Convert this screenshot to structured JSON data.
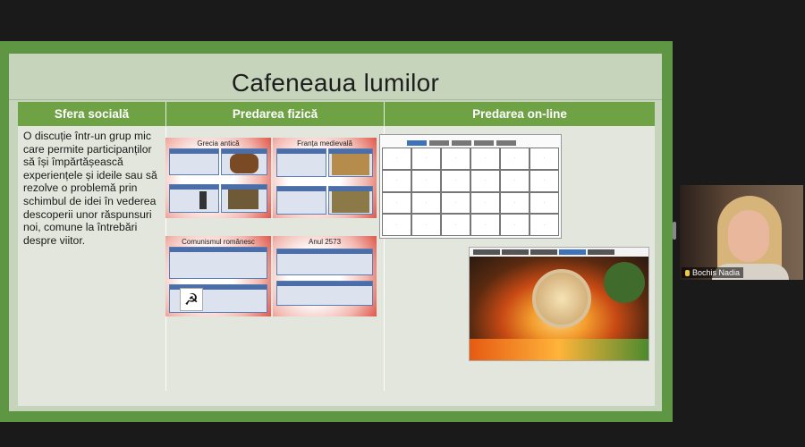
{
  "slide": {
    "title": "Cafeneaua lumilor",
    "headers": [
      "Sfera socială",
      "Predarea fizică",
      "Predarea on-line"
    ],
    "description": "O discuție într-un grup mic care permite participanților să își împărtășească experiențele și ideile sau să rezolve o problemă prin schimbul de idei în vederea descoperii unor răspunsuri noi, comune la întrebări despre viitor.",
    "thumbnails": [
      {
        "title": "Grecia antică"
      },
      {
        "title": "Franța medievală"
      },
      {
        "title": "Comunismul românesc"
      },
      {
        "title": "Anul 2573"
      }
    ]
  },
  "participant": {
    "name": "Bochis Nadia"
  },
  "colors": {
    "frame": "#5f9644",
    "header": "#6fa245",
    "slide_bg": "#c7d4bc"
  }
}
